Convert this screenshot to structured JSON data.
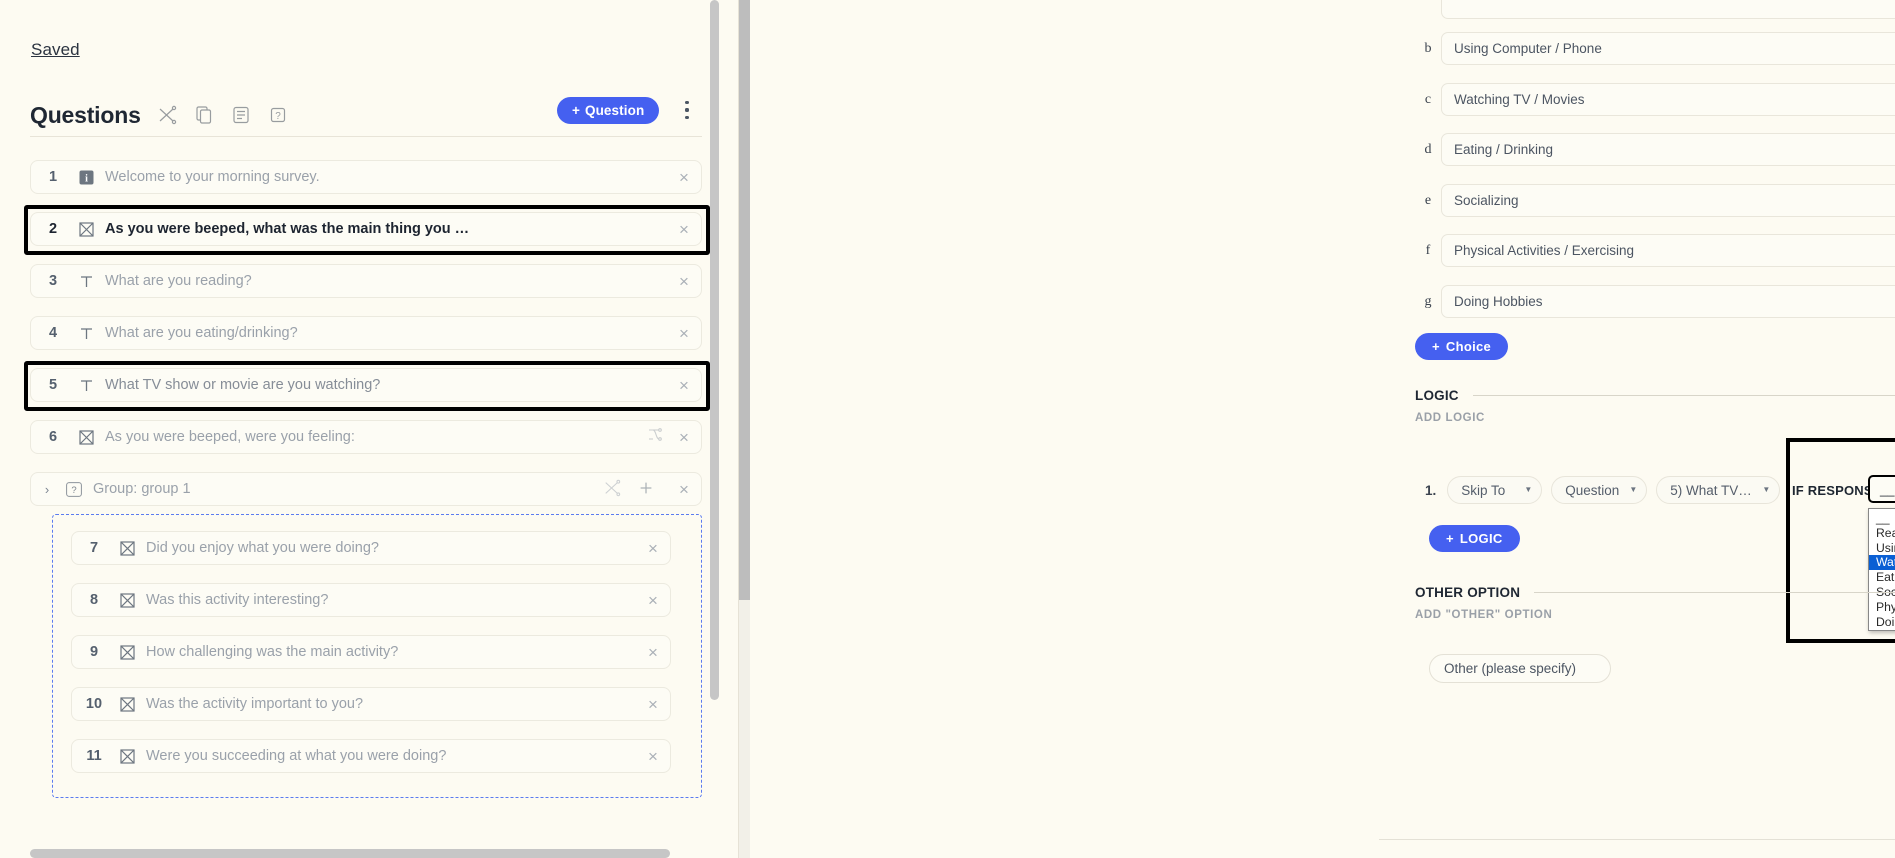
{
  "left": {
    "saved_label": "Saved",
    "questions_title": "Questions",
    "header_icons": [
      {
        "name": "shuffle-icon"
      },
      {
        "name": "copy-icon"
      },
      {
        "name": "list-icon"
      },
      {
        "name": "help-icon"
      }
    ],
    "add_question_label": "Question",
    "add_question_plus": "+",
    "questions": [
      {
        "num": "1",
        "icon": "info",
        "text": "Welcome to your morning survey.",
        "state": "normal"
      },
      {
        "num": "2",
        "icon": "multiple-choice",
        "text": "As you were beeped, what was the main thing you …",
        "state": "active"
      },
      {
        "num": "3",
        "icon": "text",
        "text": "What are you reading?",
        "state": "normal"
      },
      {
        "num": "4",
        "icon": "text",
        "text": "What are you eating/drinking?",
        "state": "normal"
      },
      {
        "num": "5",
        "icon": "text",
        "text": "What TV show or movie are you watching?",
        "state": "highlighted"
      },
      {
        "num": "6",
        "icon": "multiple-choice",
        "text": "As you were beeped, were you feeling:",
        "state": "normal",
        "has_logic_icon": true
      }
    ],
    "group": {
      "label": "Group: group 1",
      "icon": "question-mark",
      "chevron": "›",
      "items": [
        {
          "num": "7",
          "icon": "multiple-choice",
          "text": "Did you enjoy what you were doing?"
        },
        {
          "num": "8",
          "icon": "multiple-choice",
          "text": "Was this activity interesting?"
        },
        {
          "num": "9",
          "icon": "multiple-choice",
          "text": "How challenging was the main activity?"
        },
        {
          "num": "10",
          "icon": "multiple-choice",
          "text": "Was the activity important to you?"
        },
        {
          "num": "11",
          "icon": "multiple-choice",
          "text": "Were you succeeding at what you were doing?"
        }
      ]
    },
    "close_glyph": "×"
  },
  "right": {
    "choices": [
      {
        "letter": "b",
        "value": "Using Computer / Phone"
      },
      {
        "letter": "c",
        "value": "Watching TV / Movies"
      },
      {
        "letter": "d",
        "value": "Eating / Drinking"
      },
      {
        "letter": "e",
        "value": "Socializing"
      },
      {
        "letter": "f",
        "value": "Physical Activities / Exercising"
      },
      {
        "letter": "g",
        "value": "Doing Hobbies"
      }
    ],
    "add_choice_label": "Choice",
    "add_choice_plus": "+",
    "logic_section_label": "LOGIC",
    "add_logic_sub_label": "ADD LOGIC",
    "logic_rule": {
      "number": "1.",
      "action": "Skip To",
      "target_type": "Question",
      "target": "5) What TV show or ...",
      "if_response_label": "IF RESPONSE",
      "if_response_value": "__",
      "close_glyph": "×"
    },
    "dropdown": {
      "open": true,
      "options": [
        "__",
        "Reading",
        "Using Computer / Phone",
        "Watching TV / Movies",
        "Eating / Drinking",
        "Socializing",
        "Physical Activities / Exercising",
        "Doing Hobbies"
      ],
      "selected": "Watching TV / Movies",
      "selected_index": 3,
      "highlight_color": "#0a5fd4"
    },
    "add_logic_button_label": "LOGIC",
    "add_logic_button_plus": "+",
    "other_section_label": "OTHER OPTION",
    "add_other_sub_label": "ADD \"OTHER\" OPTION",
    "other_input_value": "Other (please specify)",
    "toggles": {
      "logic_on": true,
      "other_on": true,
      "color": "#21ca62"
    },
    "choice_close_glyph": "×"
  }
}
